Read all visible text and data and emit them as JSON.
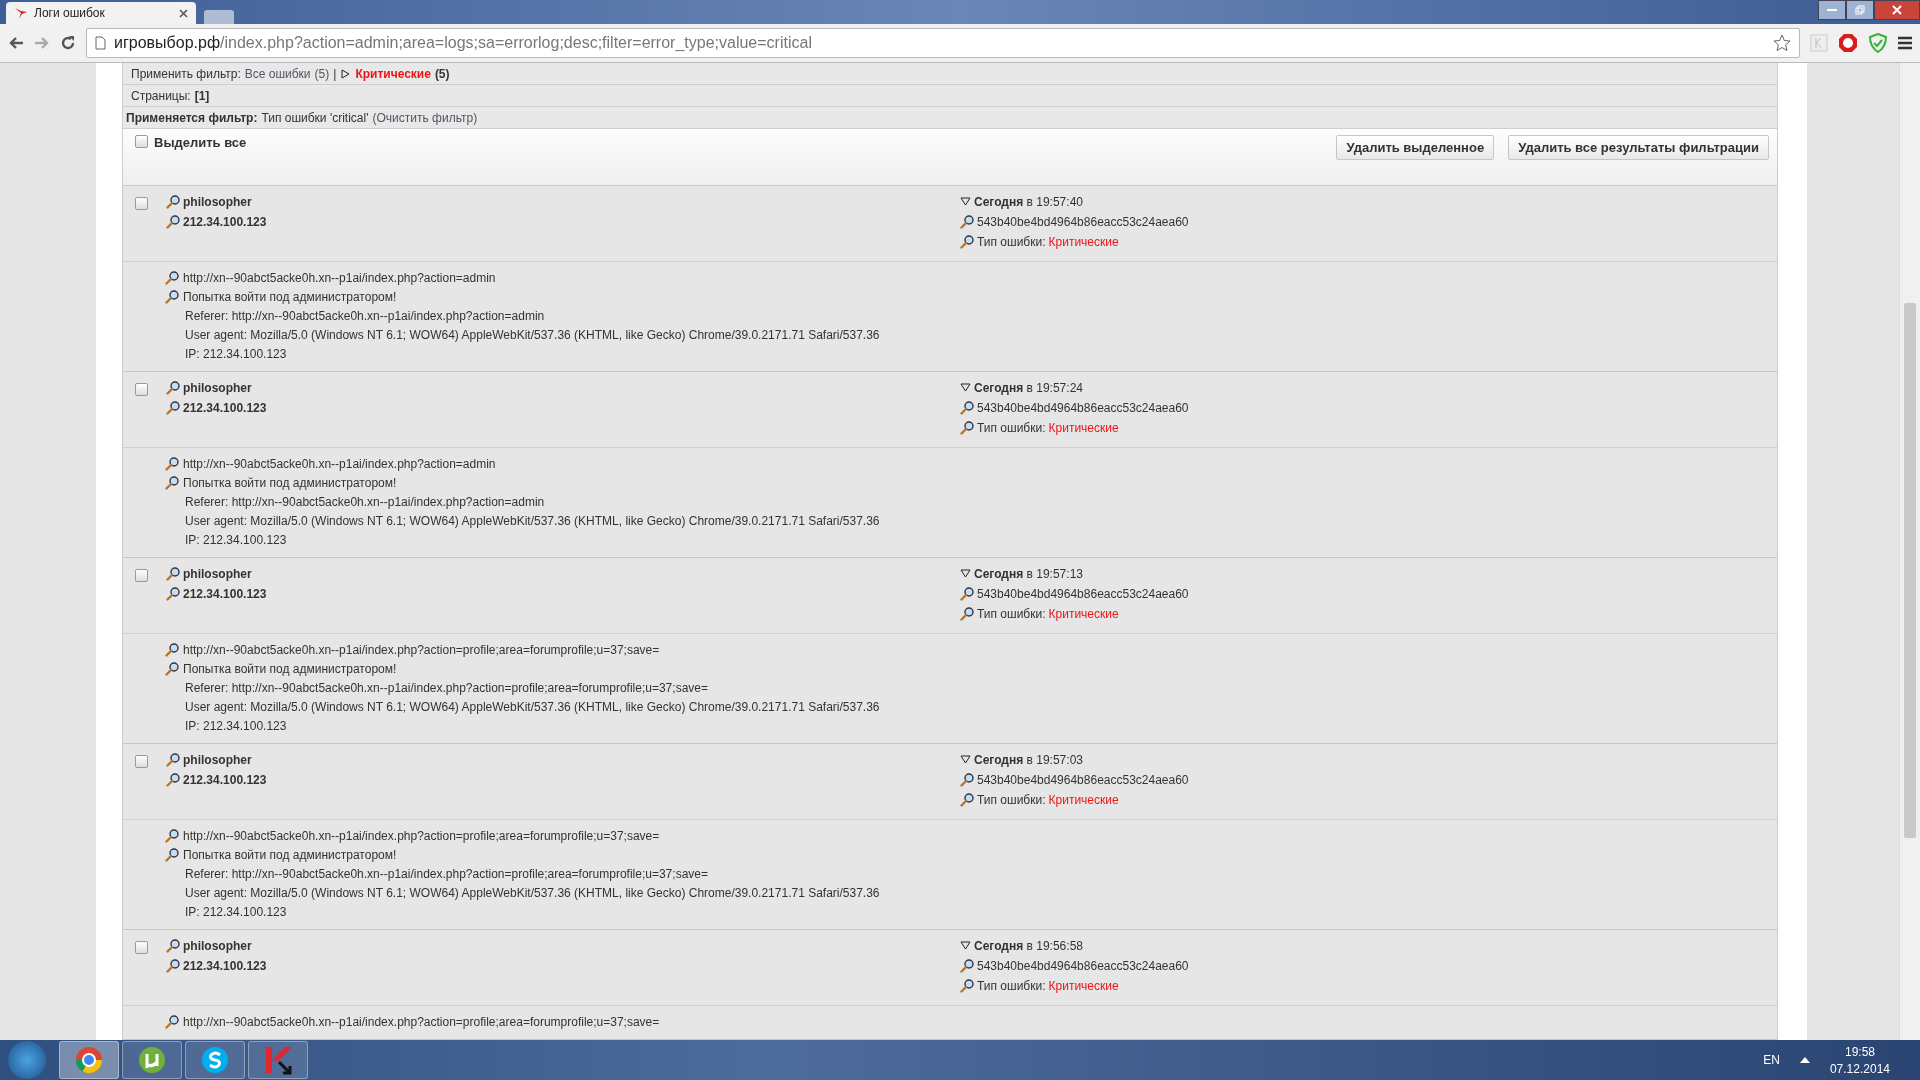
{
  "browser": {
    "tab_title": "Логи ошибок",
    "url_host": "игровыбор.рф",
    "url_path": "/index.php?action=admin;area=logs;sa=errorlog;desc;filter=error_type;value=critical"
  },
  "filter": {
    "label": "Применить фильтр:",
    "separator": "|",
    "options": [
      {
        "label": "Все ошибки",
        "count": "(5)",
        "selected": false
      },
      {
        "label": "Критические",
        "count": "(5)",
        "selected": true
      }
    ]
  },
  "pages": {
    "label": "Страницы:",
    "current": "[1]"
  },
  "applied": {
    "label": "Применяется фильтр:",
    "value": "Тип ошибки 'critical'",
    "clear": "(Очистить фильтр)"
  },
  "select_all": {
    "label": "Выделить все",
    "checked": false
  },
  "buttons": [
    "Удалить выделенное",
    "Удалить все результаты фильтрации"
  ],
  "entries": [
    {
      "checked": false,
      "user": "philosopher",
      "ip": "212.34.100.123",
      "time": "**Сегодня** в 19:57:40",
      "hash": "543b40be4bd4964b86eacc53c24aea60",
      "type_label": "Тип ошибки:",
      "type_value": "Критические",
      "details": [
        {
          "kind": "icon",
          "text": "http://xn--90abct5acke0h.xn--p1ai/index.php?action=admin"
        },
        {
          "kind": "icon",
          "text": "Попытка войти под администратором!"
        },
        {
          "kind": "plain",
          "text": "Referer: http://xn--90abct5acke0h.xn--p1ai/index.php?action=admin"
        },
        {
          "kind": "plain",
          "text": "User agent: Mozilla/5.0 (Windows NT 6.1; WOW64) AppleWebKit/537.36 (KHTML, like Gecko) Chrome/39.0.2171.71 Safari/537.36"
        },
        {
          "kind": "plain",
          "text": "IP: 212.34.100.123"
        }
      ]
    },
    {
      "checked": false,
      "user": "philosopher",
      "ip": "212.34.100.123",
      "time": "**Сегодня** в 19:57:24",
      "hash": "543b40be4bd4964b86eacc53c24aea60",
      "type_label": "Тип ошибки:",
      "type_value": "Критические",
      "details": [
        {
          "kind": "icon",
          "text": "http://xn--90abct5acke0h.xn--p1ai/index.php?action=admin"
        },
        {
          "kind": "icon",
          "text": "Попытка войти под администратором!"
        },
        {
          "kind": "plain",
          "text": "Referer: http://xn--90abct5acke0h.xn--p1ai/index.php?action=admin"
        },
        {
          "kind": "plain",
          "text": "User agent: Mozilla/5.0 (Windows NT 6.1; WOW64) AppleWebKit/537.36 (KHTML, like Gecko) Chrome/39.0.2171.71 Safari/537.36"
        },
        {
          "kind": "plain",
          "text": "IP: 212.34.100.123"
        }
      ]
    },
    {
      "checked": false,
      "user": "philosopher",
      "ip": "212.34.100.123",
      "time": "**Сегодня** в 19:57:13",
      "hash": "543b40be4bd4964b86eacc53c24aea60",
      "type_label": "Тип ошибки:",
      "type_value": "Критические",
      "details": [
        {
          "kind": "icon",
          "text": "http://xn--90abct5acke0h.xn--p1ai/index.php?action=profile;area=forumprofile;u=37;save="
        },
        {
          "kind": "icon",
          "text": "Попытка войти под администратором!"
        },
        {
          "kind": "plain",
          "text": "Referer: http://xn--90abct5acke0h.xn--p1ai/index.php?action=profile;area=forumprofile;u=37;save="
        },
        {
          "kind": "plain",
          "text": "User agent: Mozilla/5.0 (Windows NT 6.1; WOW64) AppleWebKit/537.36 (KHTML, like Gecko) Chrome/39.0.2171.71 Safari/537.36"
        },
        {
          "kind": "plain",
          "text": "IP: 212.34.100.123"
        }
      ]
    },
    {
      "checked": false,
      "user": "philosopher",
      "ip": "212.34.100.123",
      "time": "**Сегодня** в 19:57:03",
      "hash": "543b40be4bd4964b86eacc53c24aea60",
      "type_label": "Тип ошибки:",
      "type_value": "Критические",
      "details": [
        {
          "kind": "icon",
          "text": "http://xn--90abct5acke0h.xn--p1ai/index.php?action=profile;area=forumprofile;u=37;save="
        },
        {
          "kind": "icon",
          "text": "Попытка войти под администратором!"
        },
        {
          "kind": "plain",
          "text": "Referer: http://xn--90abct5acke0h.xn--p1ai/index.php?action=profile;area=forumprofile;u=37;save="
        },
        {
          "kind": "plain",
          "text": "User agent: Mozilla/5.0 (Windows NT 6.1; WOW64) AppleWebKit/537.36 (KHTML, like Gecko) Chrome/39.0.2171.71 Safari/537.36"
        },
        {
          "kind": "plain",
          "text": "IP: 212.34.100.123"
        }
      ]
    },
    {
      "checked": false,
      "user": "philosopher",
      "ip": "212.34.100.123",
      "time": "**Сегодня** в 19:56:58",
      "hash": "543b40be4bd4964b86eacc53c24aea60",
      "type_label": "Тип ошибки:",
      "type_value": "Критические",
      "details": [
        {
          "kind": "icon",
          "text": "http://xn--90abct5acke0h.xn--p1ai/index.php?action=profile;area=forumprofile;u=37;save="
        }
      ]
    }
  ],
  "taskbar": {
    "apps": [
      {
        "kind": "chrome",
        "selected": true
      },
      {
        "kind": "utorrent",
        "selected": false
      },
      {
        "kind": "skype",
        "selected": false
      },
      {
        "kind": "kaspersky",
        "selected": false
      }
    ],
    "language": "EN",
    "time": "19:58",
    "date": "07.12.2014"
  }
}
